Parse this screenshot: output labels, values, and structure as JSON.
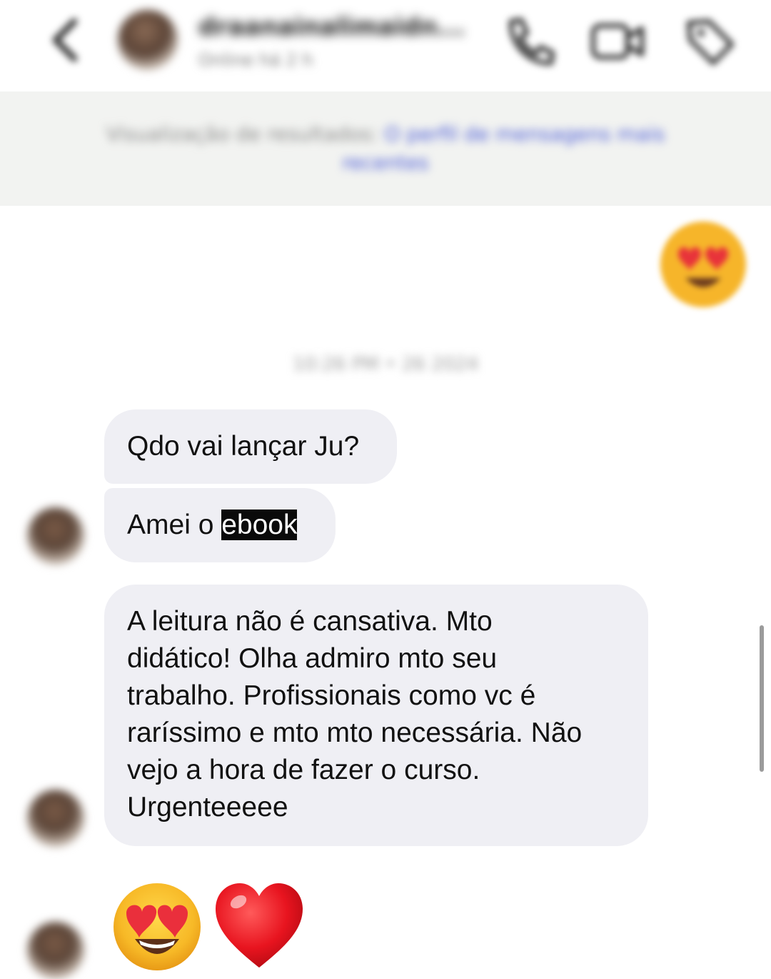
{
  "header": {
    "contact_name": "draanainalimaidn...",
    "contact_status": "Online há 2 h",
    "icons": {
      "back": "chevron-left-icon",
      "call": "phone-icon",
      "video": "video-camera-icon",
      "tag": "tag-icon"
    }
  },
  "notice": {
    "text": "Visualização de resultados:",
    "link": "O perfil de mensagens mais recentes"
  },
  "conversation": {
    "sent_emoji": "😍",
    "timestamp": "10:26 PM • 26 2024",
    "messages": [
      {
        "text": "Qdo vai lançar Ju?"
      },
      {
        "text_before": "Amei o ",
        "highlight": "ebook"
      },
      {
        "lines": [
          "A leitura não é cansativa. Mto",
          "didático! Olha admiro mto seu",
          "trabalho. Profissionais como vc é",
          "raríssimo e mto mto necessária. Não",
          "vejo a hora de fazer o curso.",
          "Urgenteeeee"
        ]
      }
    ],
    "reaction_emojis": [
      "😍",
      "❤️"
    ]
  },
  "colors": {
    "bubble_bg": "#efeff4",
    "highlight_bg": "#0a0a0a",
    "notice_bg": "#f2f3f1",
    "link": "#4a5bd6"
  }
}
